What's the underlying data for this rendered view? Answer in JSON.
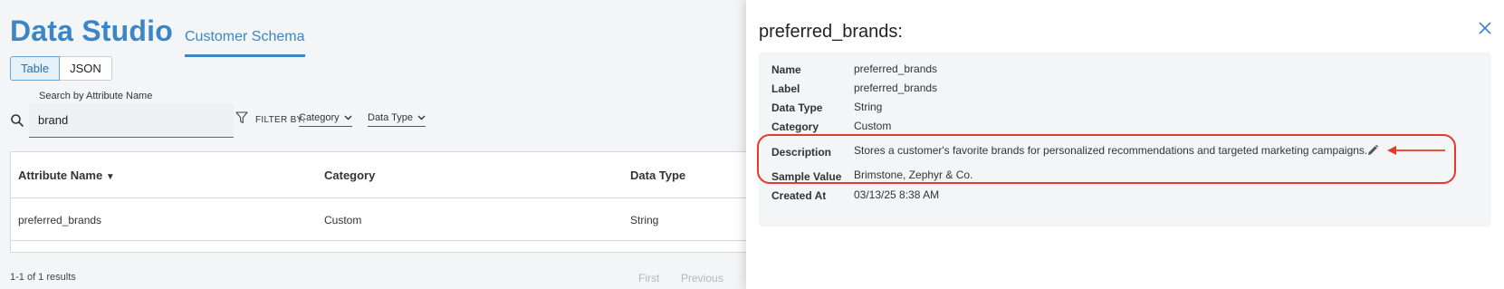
{
  "app": {
    "title": "Data Studio",
    "tab": "Customer Schema",
    "view_toggle": [
      "Table",
      "JSON"
    ],
    "search": {
      "label": "Search by Attribute Name",
      "value": "brand"
    },
    "filter": {
      "label": "FILTER BY:",
      "category": "Category",
      "data_type": "Data Type"
    },
    "table": {
      "columns": [
        "Attribute Name",
        "Category",
        "Data Type"
      ],
      "sort_indicator": "▼",
      "rows": [
        {
          "attribute_name": "preferred_brands",
          "category": "Custom",
          "data_type": "String"
        }
      ]
    },
    "results": "1-1 of 1 results",
    "pager": {
      "first": "First",
      "previous": "Previous"
    }
  },
  "drawer": {
    "title": "preferred_brands:",
    "fields": {
      "name": {
        "label": "Name",
        "value": "preferred_brands"
      },
      "label": {
        "label": "Label",
        "value": "preferred_brands"
      },
      "data_type": {
        "label": "Data Type",
        "value": "String"
      },
      "category": {
        "label": "Category",
        "value": "Custom"
      },
      "description": {
        "label": "Description",
        "value": "Stores a customer's favorite brands for personalized recommendations and targeted marketing campaigns."
      },
      "sample_value": {
        "label": "Sample Value",
        "value": "Brimstone, Zephyr & Co."
      },
      "created_at": {
        "label": "Created At",
        "value": "03/13/25 8:38 AM"
      }
    }
  },
  "icons": {
    "search": "search-icon",
    "filter": "filter-icon",
    "chevron": "chevron-down-icon",
    "close": "close-icon",
    "edit": "pencil-icon",
    "arrow": "arrow-left-icon"
  },
  "colors": {
    "accent": "#3d86c6",
    "annotation": "#e53a2a"
  }
}
